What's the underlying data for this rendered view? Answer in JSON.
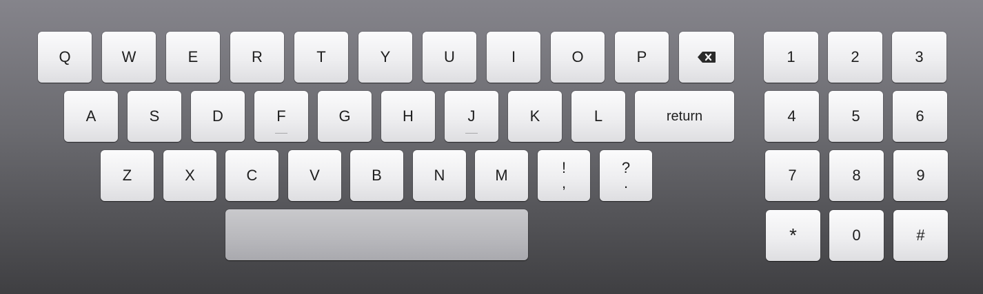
{
  "letters": {
    "row1": [
      "Q",
      "W",
      "E",
      "R",
      "T",
      "Y",
      "U",
      "I",
      "O",
      "P"
    ],
    "row2": [
      "A",
      "S",
      "D",
      "F",
      "G",
      "H",
      "J",
      "K",
      "L"
    ],
    "row3": [
      "Z",
      "X",
      "C",
      "V",
      "B",
      "N",
      "M"
    ]
  },
  "punct": [
    {
      "top": "!",
      "bottom": ","
    },
    {
      "top": "?",
      "bottom": "."
    }
  ],
  "return_label": "return",
  "backspace_icon": "backspace-icon",
  "numpad": [
    "1",
    "2",
    "3",
    "4",
    "5",
    "6",
    "7",
    "8",
    "9",
    "*",
    "0",
    "#"
  ]
}
